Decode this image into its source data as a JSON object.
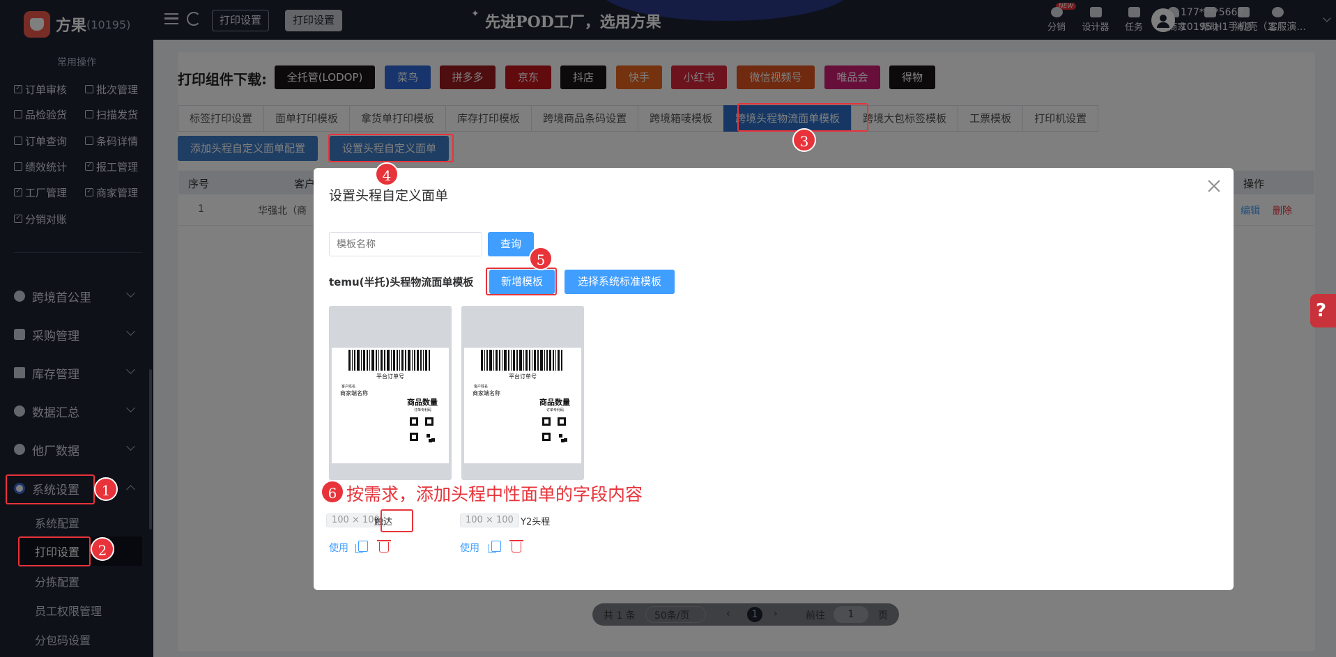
{
  "app": {
    "name": "方果",
    "id": "(10195)"
  },
  "header": {
    "tabs": [
      "打印设置",
      "打印设置"
    ],
    "slogan": "先进POD工厂，选用方果",
    "new_badge": "NEW",
    "tools": [
      "分销",
      "设计器",
      "任务",
      "邀商家",
      "帮助",
      "消息",
      "客服"
    ],
    "user_phone": "177****5667",
    "user_name": "10195 H1手机壳（工厂演..."
  },
  "sidebar": {
    "quick_title": "常用操作",
    "quick": [
      "订单审核",
      "批次管理",
      "品检验货",
      "扫描发货",
      "订单查询",
      "条码详情",
      "绩效统计",
      "报工管理",
      "工厂管理",
      "商家管理",
      "分销对账"
    ],
    "menus": [
      "跨境首公里",
      "采购管理",
      "库存管理",
      "数据汇总",
      "他厂数据",
      "系统设置"
    ],
    "subs": [
      "系统配置",
      "打印设置",
      "分拣配置",
      "员工权限管理",
      "分包码设置"
    ]
  },
  "main": {
    "download_title": "打印组件下载:",
    "downloads": [
      "全托管(LODOP)",
      "菜鸟",
      "拼多多",
      "京东",
      "抖店",
      "快手",
      "小红书",
      "微信视频号",
      "唯品会",
      "得物"
    ],
    "tabs": [
      "标签打印设置",
      "面单打印模板",
      "拿货单打印模板",
      "库存打印模板",
      "跨境商品条码设置",
      "跨境箱唛模板",
      "跨境头程物流面单模板",
      "跨境大包标签模板",
      "工票模板",
      "打印机设置"
    ],
    "add_btn": "添加头程自定义面单配置",
    "set_btn": "设置头程自定义面单",
    "table": {
      "headers": [
        "序号",
        "客户",
        "操作"
      ],
      "row": {
        "no": "1",
        "customer": "华强北（商",
        "edit": "编辑",
        "delete": "删除"
      }
    },
    "pager": {
      "total": "共 1 条",
      "size": "50条/页",
      "page": "1",
      "goto": "前往",
      "goto_val": "1",
      "unit": "页"
    }
  },
  "modal": {
    "title": "设置头程自定义面单",
    "search_placeholder": "模板名称",
    "query_btn": "查询",
    "section_label": "temu(半托)头程物流面单模板",
    "add_btn": "新增模板",
    "select_btn": "选择系统标准模板",
    "templates": [
      {
        "size": "100 × 100",
        "name": "触达",
        "use": "使用"
      },
      {
        "size": "100 × 100",
        "name": "Y2头程",
        "use": "使用"
      }
    ],
    "label_preview": {
      "order_no": "平台订单号",
      "customer": "客户姓名",
      "merchant": "商家端名称",
      "goods": "商品数量",
      "goods_sub": "订单专利码"
    }
  },
  "annotations": {
    "steps": [
      "1",
      "2",
      "3",
      "4",
      "5",
      "6"
    ],
    "note": "按需求，添加头程中性面单的字段内容"
  }
}
